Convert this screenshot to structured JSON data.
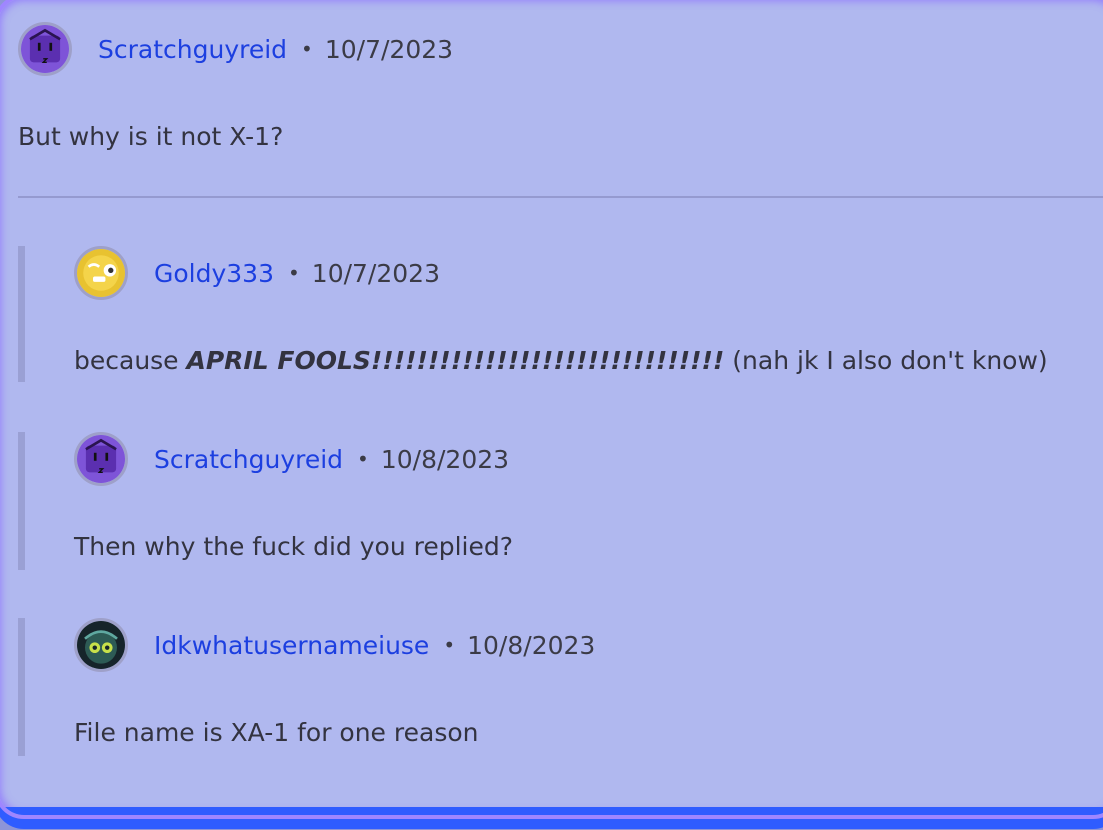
{
  "root_comment": {
    "username": "Scratchguyreid",
    "separator": "•",
    "date": "10/7/2023",
    "text": "But why is it not X-1?",
    "avatar_icon": "purple-box-face-avatar"
  },
  "replies": [
    {
      "username": "Goldy333",
      "separator": "•",
      "date": "10/7/2023",
      "text_prefix": "because ",
      "text_bold": "APRIL FOOLS!!!!!!!!!!!!!!!!!!!!!!!!!!!!!!!",
      "text_suffix": " (nah jk I also don't know)",
      "avatar_icon": "yellow-smiley-face-avatar"
    },
    {
      "username": "Scratchguyreid",
      "separator": "•",
      "date": "10/8/2023",
      "text": "Then why the fuck did you replied?",
      "avatar_icon": "purple-box-face-avatar"
    },
    {
      "username": "Idkwhatusernameiuse",
      "separator": "•",
      "date": "10/8/2023",
      "text": "File name is XA-1 for one reason",
      "avatar_icon": "green-creature-avatar"
    }
  ],
  "colors": {
    "card_bg": "#b0b8ef",
    "username": "#1c3fe0",
    "text": "#333340",
    "glow": "#9f86ff",
    "bottom_bar": "#2f5cff"
  }
}
